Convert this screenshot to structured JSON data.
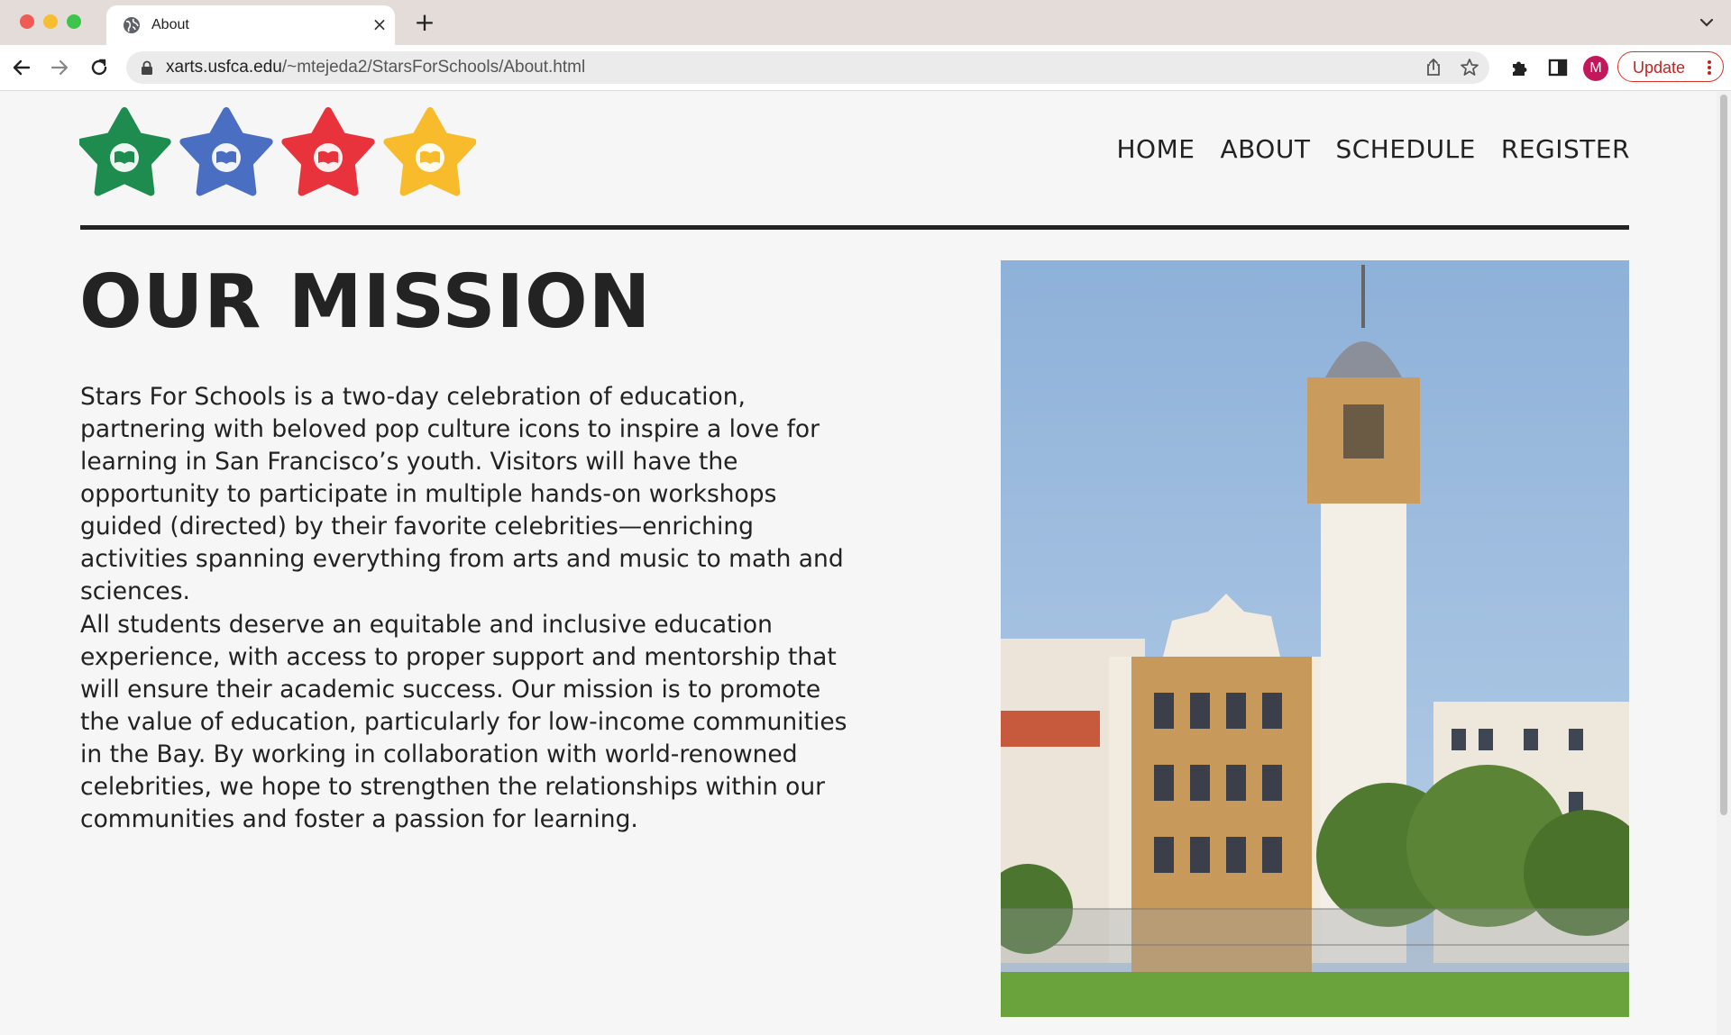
{
  "browser": {
    "tab_title": "About",
    "tab_close_glyph": "×",
    "new_tab_glyph": "+",
    "url_host": "xarts.usfca.edu",
    "url_path": "/~mtejeda2/StarsForSchools/About.html",
    "profile_initial": "M",
    "update_label": "Update"
  },
  "site": {
    "logo_stars": [
      {
        "color": "#1e8c4e",
        "icon": "book-icon"
      },
      {
        "color": "#4a6fc2",
        "icon": "book-icon"
      },
      {
        "color": "#e8323c",
        "icon": "book-icon"
      },
      {
        "color": "#f7bb2c",
        "icon": "book-icon"
      }
    ],
    "nav": [
      "HOME",
      "ABOUT",
      "SCHEDULE",
      "REGISTER"
    ],
    "heading": "OUR MISSION",
    "paragraphs": [
      "Stars For Schools is a two-day celebration of education, partnering with beloved pop culture icons to inspire a love for learning in San Francisco’s youth. Visitors will have the opportunity to participate in multiple hands-on workshops guided (directed) by their favorite celebrities—enriching activities spanning everything from arts and music to math and sciences.",
      "All students deserve an equitable and inclusive education experience, with access to proper support and mentorship that will ensure their academic success. Our mission is to promote the value of education, particularly for low-income communities in the Bay. By working in collaboration with world-renowned celebrities, we hope to strengthen the relationships within our communities and foster a passion for learning."
    ]
  },
  "colors": {
    "accent_red": "#d93025",
    "text_dark": "#232323",
    "page_bg": "#f6f6f6"
  }
}
